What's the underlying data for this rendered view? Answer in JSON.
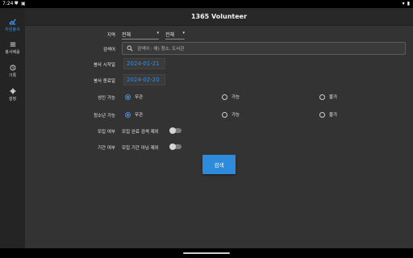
{
  "status_bar": {
    "time": "7:24"
  },
  "app_title": "1365 Volunteer",
  "nav": [
    {
      "label": "자원봉사",
      "icon": "volunteer-icon",
      "active": true
    },
    {
      "label": "봉사배움",
      "icon": "list-icon",
      "active": false
    },
    {
      "label": "기록",
      "icon": "history-icon",
      "active": false
    },
    {
      "label": "설정",
      "icon": "gear-icon",
      "active": false
    }
  ],
  "form": {
    "region_label": "지역",
    "region_value_1": "전체",
    "region_value_2": "전체",
    "keyword_label": "검색어",
    "keyword_placeholder": "검색어 : 예) 청소, 도서관",
    "start_label": "봉사 시작일",
    "start_date": "2024-01-21",
    "end_label": "봉사 종료일",
    "end_date": "2024-02-20",
    "adult_label": "성인 가능",
    "youth_label": "청소년 가능",
    "options": [
      "무관",
      "가능",
      "불가"
    ],
    "adult_selected": "무관",
    "youth_selected": "무관",
    "recruit_label": "모집 여부",
    "recruit_toggle_text": "모집 완료 검색 제외",
    "period_label": "기간 여부",
    "period_toggle_text": "모집 기간 아님 제외",
    "search_button": "검색"
  },
  "colors": {
    "accent": "#2e8bdc",
    "background": "#333333",
    "sidebar": "#242424"
  }
}
